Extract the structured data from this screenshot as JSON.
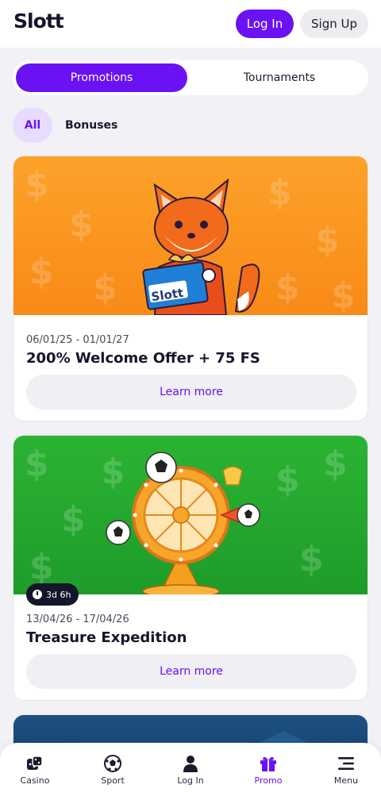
{
  "header": {
    "logo": "Slott",
    "login_label": "Log In",
    "signup_label": "Sign Up"
  },
  "tabs": [
    {
      "label": "Promotions",
      "active": true
    },
    {
      "label": "Tournaments",
      "active": false
    }
  ],
  "filters": [
    {
      "label": "All",
      "active": true
    },
    {
      "label": "Bonuses",
      "active": false
    }
  ],
  "promos": [
    {
      "dates": "06/01/25 - 01/01/27",
      "title": "200% Welcome Offer + 75 FS",
      "cta": "Learn more",
      "banner_color": "#fca22a",
      "mascot_text": "Slott"
    },
    {
      "dates": "13/04/26 - 17/04/26",
      "title": "Treasure Expedition",
      "cta": "Learn more",
      "banner_color": "#2bb333",
      "timer": "3d 6h"
    },
    {
      "banner_color": "#1c4f80"
    }
  ],
  "bottom_nav": [
    {
      "label": "Casino",
      "icon": "dice-icon",
      "active": false
    },
    {
      "label": "Sport",
      "icon": "soccer-ball-icon",
      "active": false
    },
    {
      "label": "Log In",
      "icon": "user-icon",
      "active": false
    },
    {
      "label": "Promo",
      "icon": "gift-icon",
      "active": true
    },
    {
      "label": "Menu",
      "icon": "menu-icon",
      "active": false
    }
  ],
  "colors": {
    "accent": "#6a12f4",
    "background": "#f1f1f6",
    "chip_active_bg": "#e7dcff"
  }
}
